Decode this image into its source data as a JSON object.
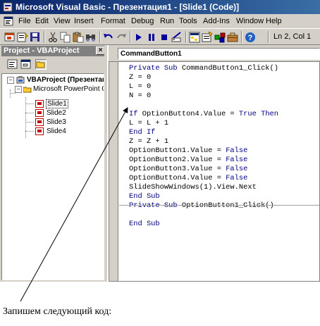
{
  "window": {
    "title": "Microsoft Visual Basic - Презентация1 - [Slide1 (Code)]"
  },
  "menu": {
    "items": [
      "File",
      "Edit",
      "View",
      "Insert",
      "Format",
      "Debug",
      "Run",
      "Tools",
      "Add-Ins",
      "Window",
      "Help"
    ]
  },
  "toolbar": {
    "buttons": [
      "view-powerpoint-icon",
      "insert-module-icon",
      "save-icon",
      "cut-icon",
      "copy-icon",
      "paste-icon",
      "find-icon",
      "undo-icon",
      "redo-icon",
      "run-icon",
      "break-icon",
      "reset-icon",
      "design-mode-icon",
      "project-explorer-icon",
      "properties-icon",
      "object-browser-icon",
      "toolbox-icon",
      "help-icon"
    ],
    "position": "Ln 2, Col 1"
  },
  "project_panel": {
    "title": "Project - VBAProject",
    "close": "×",
    "tree": {
      "root": "VBAProject (Презентаци",
      "objects_folder": "Microsoft PowerPoint Ob",
      "slides": [
        "Slide1",
        "Slide2",
        "Slide3",
        "Slide4"
      ],
      "selected": "Slide1"
    }
  },
  "code_window": {
    "object": "CommandButton1",
    "lines": [
      {
        "parts": [
          {
            "kw": "Private Sub "
          },
          {
            "t": "CommandButton1_Click()"
          }
        ]
      },
      {
        "parts": [
          {
            "t": "Z = 0"
          }
        ]
      },
      {
        "parts": [
          {
            "t": "L = 0"
          }
        ]
      },
      {
        "parts": [
          {
            "t": "N = 0"
          }
        ]
      },
      {
        "parts": []
      },
      {
        "parts": [
          {
            "kw": "If "
          },
          {
            "t": "OptionButton4.Value = "
          },
          {
            "kw": "True Then"
          }
        ]
      },
      {
        "parts": [
          {
            "t": "L = L + 1"
          }
        ]
      },
      {
        "parts": [
          {
            "kw": "End If"
          }
        ]
      },
      {
        "parts": [
          {
            "t": "Z = Z + 1"
          }
        ]
      },
      {
        "parts": [
          {
            "t": "OptionButton1.Value = "
          },
          {
            "kw": "False"
          }
        ]
      },
      {
        "parts": [
          {
            "t": "OptionButton2.Value = "
          },
          {
            "kw": "False"
          }
        ]
      },
      {
        "parts": [
          {
            "t": "OptionButton3.Value = "
          },
          {
            "kw": "False"
          }
        ]
      },
      {
        "parts": [
          {
            "t": "OptionButton4.Value = "
          },
          {
            "kw": "False"
          }
        ]
      },
      {
        "parts": [
          {
            "t": "SlideShowWindows(1).View.Next"
          }
        ]
      },
      {
        "parts": [
          {
            "kw": "End Sub"
          }
        ]
      },
      {
        "sep": true
      },
      {
        "parts": [
          {
            "kw": "Private Sub "
          },
          {
            "t": "OptionButton1_Click()"
          }
        ]
      },
      {
        "parts": []
      },
      {
        "parts": [
          {
            "kw": "End Sub"
          }
        ]
      }
    ]
  },
  "caption": "Запишем следующий код:"
}
